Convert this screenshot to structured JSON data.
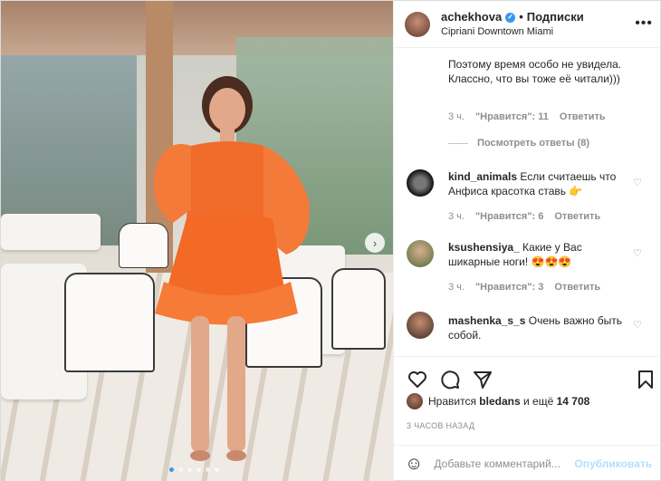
{
  "post": {
    "author": "achekhova",
    "follow_label": "Подписки",
    "separator": "•",
    "location": "Cipriani Downtown Miami",
    "more_icon": "more-icon"
  },
  "comments": [
    {
      "text": "Поэтому время особо не увидела. Классно, что вы тоже её читали)))",
      "time": "3 ч.",
      "likes": "\"Нравится\": 11",
      "reply": "Ответить"
    },
    {
      "view_replies": "Посмотреть ответы (8)"
    },
    {
      "username": "kind_animals",
      "text": " Если считаешь что Анфиса красотка ставь 👉",
      "time": "3 ч.",
      "likes": "\"Нравится\": 6",
      "reply": "Ответить"
    },
    {
      "username": "ksushensiya_",
      "text": " Какие у Вас шикарные ноги! 😍😍😍",
      "time": "3 ч.",
      "likes": "\"Нравится\": 3",
      "reply": "Ответить"
    },
    {
      "username": "mashenka_s_s",
      "text": " Очень важно быть собой."
    }
  ],
  "likes_line": {
    "prefix": "Нравится ",
    "user": "bledans",
    "middle": " и ещё ",
    "count": "14 708"
  },
  "time_ago": "3 ЧАСОВ НАЗАД",
  "add_comment": {
    "placeholder": "Добавьте комментарий...",
    "post_label": "Опубликовать"
  },
  "carousel": {
    "count": 6,
    "active": 0
  }
}
